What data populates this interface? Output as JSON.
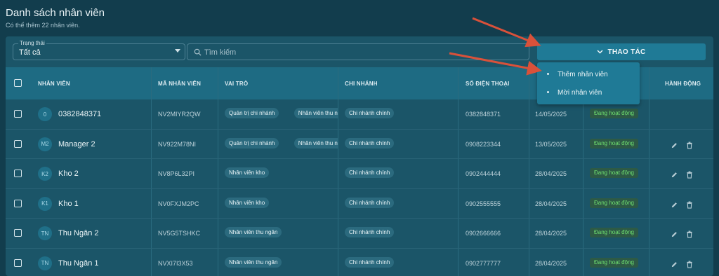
{
  "header": {
    "title": "Danh sách nhân viên",
    "subtitle": "Có thể thêm 22 nhân viên."
  },
  "filters": {
    "status_legend": "Trạng thái",
    "status_value": "Tất cả",
    "search_placeholder": "Tìm kiếm"
  },
  "actions": {
    "button_label": "THAO TÁC",
    "menu": [
      {
        "label": "Thêm nhân viên"
      },
      {
        "label": "Mời nhân viên"
      }
    ]
  },
  "table": {
    "columns": {
      "employee": "NHÂN VIÊN",
      "code": "MÃ NHÂN VIÊN",
      "role": "VAI TRÒ",
      "branch": "CHI NHÁNH",
      "phone": "SỐ ĐIỆN THOẠI",
      "actions": "HÀNH ĐỘNG"
    },
    "rows": [
      {
        "avatar": "0",
        "name": "0382848371",
        "code": "NV2MIYR2QW",
        "roles": [
          "Quản trị chi nhánh",
          "Nhân viên thu ngân"
        ],
        "branch": "Chi nhánh chính",
        "phone": "0382848371",
        "date": "14/05/2025",
        "status": "Đang hoạt động",
        "editable": false
      },
      {
        "avatar": "M2",
        "name": "Manager 2",
        "code": "NV922M78NI",
        "roles": [
          "Quản trị chi nhánh",
          "Nhân viên thu ngân"
        ],
        "branch": "Chi nhánh chính",
        "phone": "0908223344",
        "date": "13/05/2025",
        "status": "Đang hoạt động",
        "editable": true
      },
      {
        "avatar": "K2",
        "name": "Kho 2",
        "code": "NV8P6L32PI",
        "roles": [
          "Nhân viên kho"
        ],
        "branch": "Chi nhánh chính",
        "phone": "0902444444",
        "date": "28/04/2025",
        "status": "Đang hoạt động",
        "editable": true
      },
      {
        "avatar": "K1",
        "name": "Kho 1",
        "code": "NV0FXJM2PC",
        "roles": [
          "Nhân viên kho"
        ],
        "branch": "Chi nhánh chính",
        "phone": "0902555555",
        "date": "28/04/2025",
        "status": "Đang hoạt động",
        "editable": true
      },
      {
        "avatar": "TN",
        "name": "Thu Ngân 2",
        "code": "NV5G5TSHKC",
        "roles": [
          "Nhân viên thu ngân"
        ],
        "branch": "Chi nhánh chính",
        "phone": "0902666666",
        "date": "28/04/2025",
        "status": "Đang hoạt động",
        "editable": true
      },
      {
        "avatar": "TN",
        "name": "Thu Ngân 1",
        "code": "NVXI7I3X53",
        "roles": [
          "Nhân viên thu ngân"
        ],
        "branch": "Chi nhánh chính",
        "phone": "0902777777",
        "date": "28/04/2025",
        "status": "Đang hoạt động",
        "editable": true
      }
    ]
  },
  "icons": {
    "search": "search-icon",
    "chevron": "chevron-down-icon",
    "edit": "pencil-icon",
    "delete": "trash-icon"
  },
  "colors": {
    "background": "#123d4d",
    "panel": "#1b5568",
    "accent": "#1f7a96",
    "status_text": "#6fe06f",
    "annotation_arrow": "#d9513a"
  }
}
